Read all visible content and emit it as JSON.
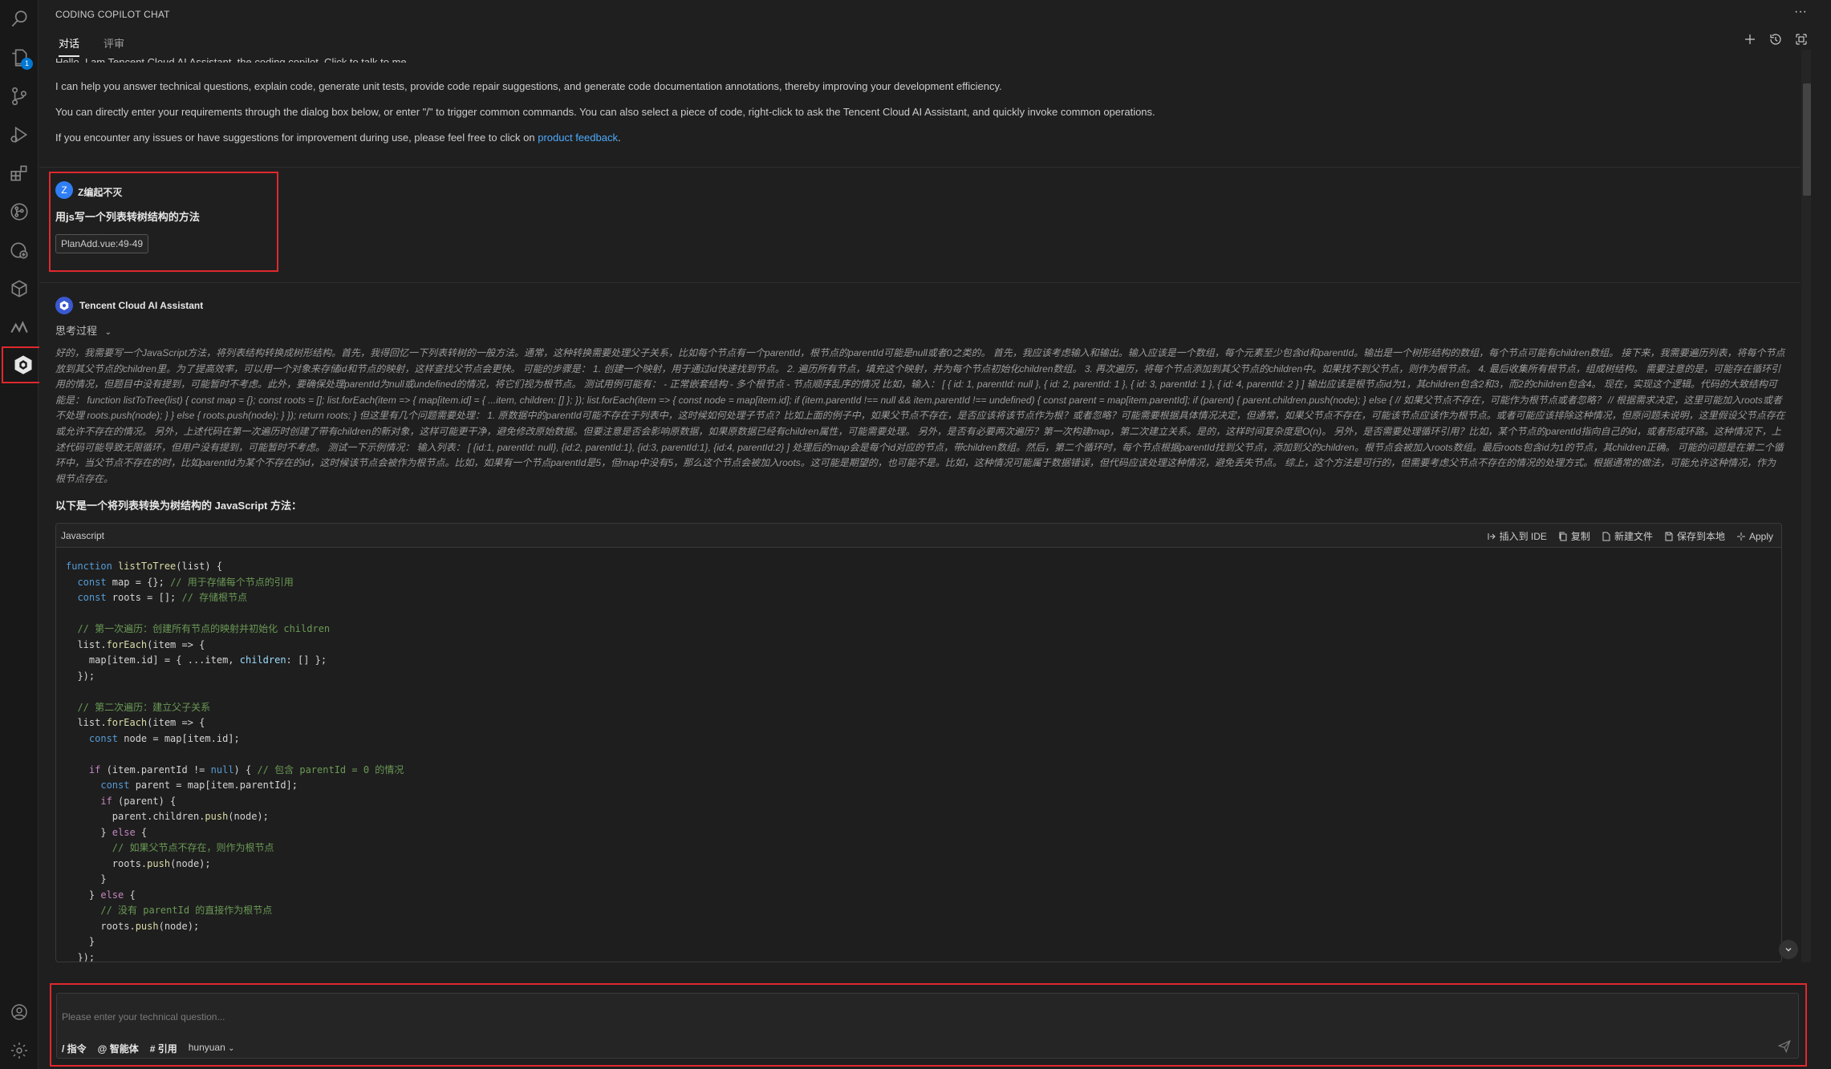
{
  "panel": {
    "title": "CODING COPILOT CHAT",
    "menu": "···",
    "tabs": [
      {
        "label": "对话",
        "active": true
      },
      {
        "label": "评审",
        "active": false
      }
    ]
  },
  "activity_bar": {
    "icons": [
      "search-icon",
      "explorer-icon",
      "source-control-icon",
      "run-debug-icon",
      "extensions-icon",
      "git-graph-icon",
      "remote-explorer-icon",
      "cube-icon",
      "deploy-icon",
      "copilot-icon"
    ],
    "explorer_badge": "1",
    "bottom_icons": [
      "account-icon",
      "settings-icon"
    ]
  },
  "intro": {
    "cut_line": "Hello, I am Tencent Cloud AI Assistant, the coding copilot. Click to talk to me.",
    "p1": "I can help you answer technical questions, explain code, generate unit tests, provide code repair suggestions, and generate code documentation annotations, thereby improving your development efficiency.",
    "p2": "You can directly enter your requirements through the dialog box below, or enter \"/\" to trigger common commands. You can also select a piece of code, right-click to ask the Tencent Cloud AI Assistant, and quickly invoke common operations.",
    "p3_prefix": "If you encounter any issues or have suggestions for improvement during use, please feel free to click on ",
    "p3_link": "product feedback",
    "p3_suffix": "."
  },
  "user_message": {
    "avatar_letter": "Z",
    "name": "Z编起不灭",
    "text": "用js写一个列表转树结构的方法",
    "file_chip": "PlanAdd.vue:49-49"
  },
  "assistant": {
    "name": "Tencent Cloud AI Assistant",
    "thinking_label": "思考过程",
    "thinking_text": "好的，我需要写一个JavaScript方法，将列表结构转换成树形结构。首先，我得回忆一下列表转树的一般方法。通常，这种转换需要处理父子关系，比如每个节点有一个parentId，根节点的parentId可能是null或者0之类的。 首先，我应该考虑输入和输出。输入应该是一个数组，每个元素至少包含id和parentId。输出是一个树形结构的数组，每个节点可能有children数组。 接下来，我需要遍历列表，将每个节点放到其父节点的children里。为了提高效率，可以用一个对象来存储id和节点的映射，这样查找父节点会更快。 可能的步骤是： 1. 创建一个映射，用于通过id快速找到节点。 2. 遍历所有节点，填充这个映射，并为每个节点初始化children数组。 3. 再次遍历，将每个节点添加到其父节点的children中。如果找不到父节点，则作为根节点。 4. 最后收集所有根节点，组成树结构。 需要注意的是，可能存在循环引用的情况，但题目中没有提到，可能暂时不考虑。此外，要确保处理parentId为null或undefined的情况，将它们视为根节点。 测试用例可能有： - 正常嵌套结构 - 多个根节点 - 节点顺序乱序的情况 比如，输入： [ { id: 1, parentId: null }, { id: 2, parentId: 1 }, { id: 3, parentId: 1 }, { id: 4, parentId: 2 } ] 输出应该是根节点id为1，其children包含2和3，而2的children包含4。 现在，实现这个逻辑。代码的大致结构可能是： function listToTree(list) { const map = {}; const roots = []; list.forEach(item => { map[item.id] = { ...item, children: [] }; }); list.forEach(item => { const node = map[item.id]; if (item.parentId !== null && item.parentId !== undefined) { const parent = map[item.parentId]; if (parent) { parent.children.push(node); } else { // 如果父节点不存在，可能作为根节点或者忽略？ // 根据需求决定，这里可能加入roots或者不处理 roots.push(node); } } else { roots.push(node); } }); return roots; } 但这里有几个问题需要处理： 1. 原数据中的parentId可能不存在于列表中，这时候如何处理子节点？比如上面的例子中，如果父节点不存在，是否应该将该节点作为根？或者忽略？可能需要根据具体情况决定，但通常，如果父节点不存在，可能该节点应该作为根节点。或者可能应该排除这种情况，但原问题未说明，这里假设父节点存在或允许不存在的情况。 另外，上述代码在第一次遍历时创建了带有children的新对象，这样可能更干净，避免修改原始数据。但要注意是否会影响原数据，如果原数据已经有children属性，可能需要处理。 另外，是否有必要两次遍历？第一次构建map，第二次建立关系。是的，这样时间复杂度是O(n)。 另外，是否需要处理循环引用？比如，某个节点的parentId指向自己的id，或者形成环路。这种情况下，上述代码可能导致无限循环，但用户没有提到，可能暂时不考虑。 测试一下示例情况： 输入列表： [ {id:1, parentId: null}, {id:2, parentId:1}, {id:3, parentId:1}, {id:4, parentId:2} ] 处理后的map会是每个id对应的节点，带children数组。然后，第二个循环时，每个节点根据parentId找到父节点，添加到父的children。根节点会被加入roots数组。最后roots包含id为1的节点，其children正确。 可能的问题是在第二个循环中，当父节点不存在的时，比如parentId为某个不存在的id，这时候该节点会被作为根节点。比如，如果有一个节点parentId是5，但map中没有5，那么这个节点会被加入roots。这可能是期望的，也可能不是。比如，这种情况可能属于数据错误，但代码应该处理这种情况，避免丢失节点。 综上，这个方法是可行的，但需要考虑父节点不存在的情况的处理方式。根据通常的做法，可能允许这种情况，作为根节点存在。",
    "answer_lead": "以下是一个将列表转换为树结构的 JavaScript 方法：",
    "code_lang": "Javascript",
    "code_actions": [
      "插入到 IDE",
      "复制",
      "新建文件",
      "保存到本地",
      "Apply"
    ]
  },
  "input": {
    "placeholder": "Please enter your technical question...",
    "value": "",
    "tools": [
      "/ 指令",
      "@ 智能体",
      "# 引用"
    ],
    "model": "hunyuan"
  },
  "colors": {
    "highlight_border": "#e0282e",
    "link": "#4daafc",
    "accent": "#0078d4"
  }
}
